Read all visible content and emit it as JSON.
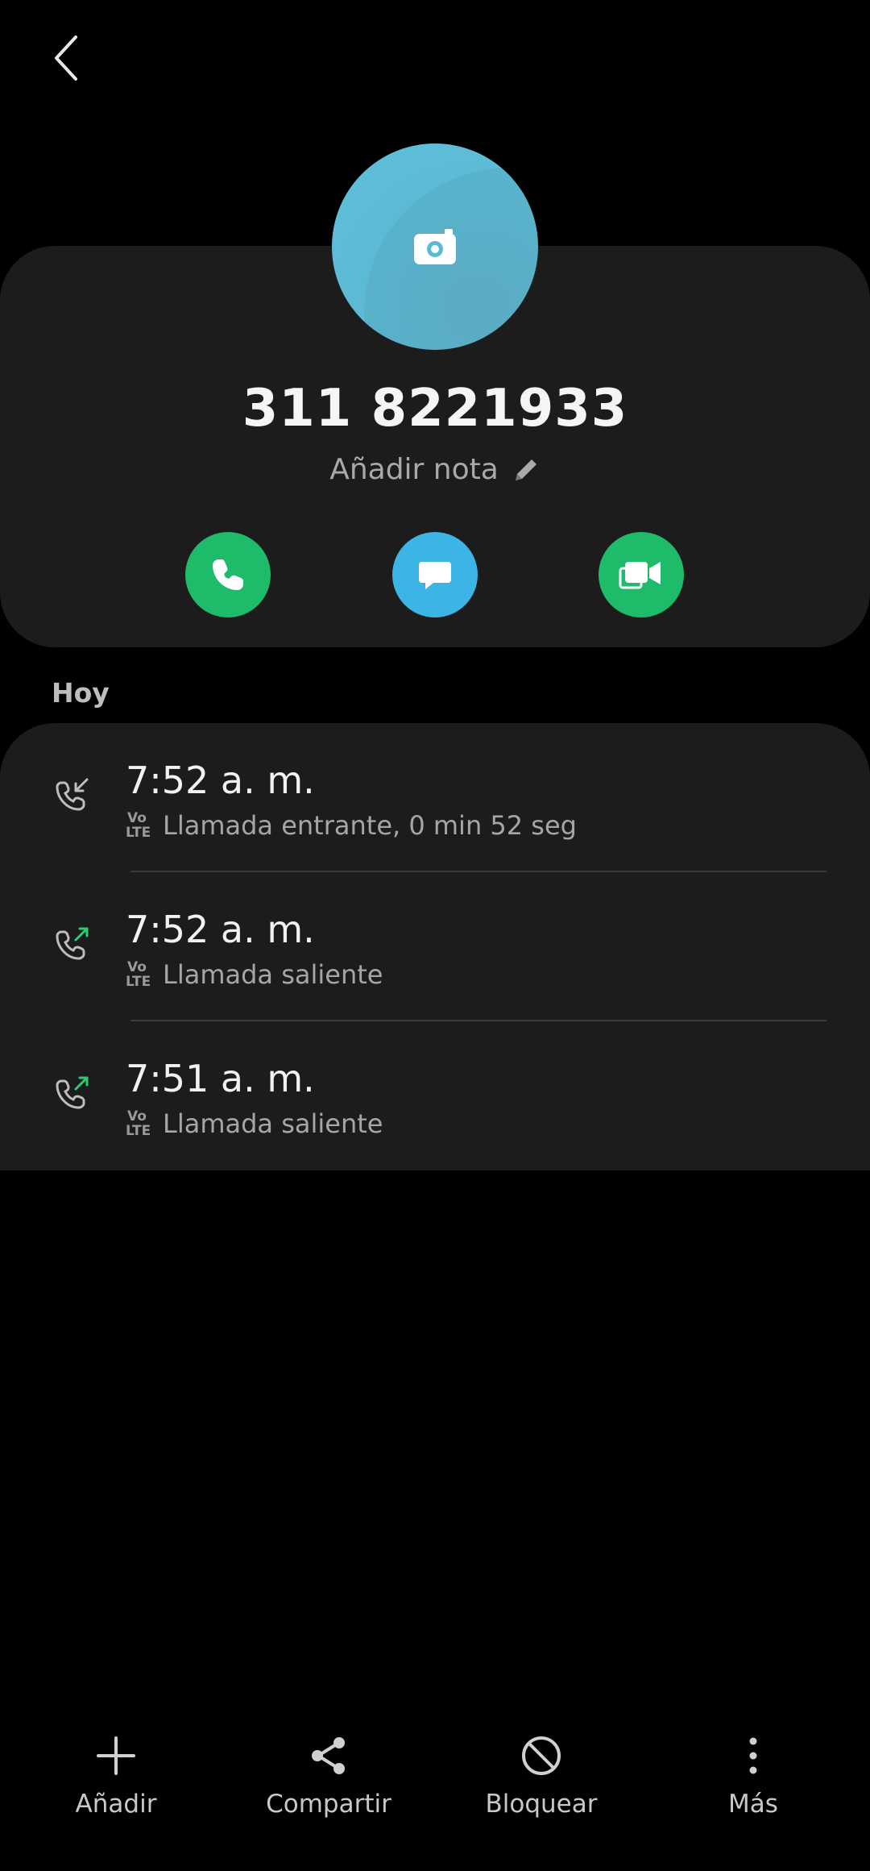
{
  "header": {
    "back_icon": "chevron-left-icon"
  },
  "contact": {
    "avatar_icon": "camera-icon",
    "avatar_color": "#5ec0da",
    "phone_number": "311 8221933",
    "note_label": "Añadir nota",
    "note_icon": "pencil-icon"
  },
  "actions": {
    "call_icon": "phone-icon",
    "message_icon": "message-icon",
    "video_icon": "video-call-icon",
    "call_color": "#1dbb6a",
    "message_color": "#3db4e6",
    "video_color": "#1dbb6a"
  },
  "log": {
    "section_label": "Hoy",
    "volte_top": "Vo",
    "volte_bottom": "LTE",
    "entries": [
      {
        "time": "7:52 a. m.",
        "description": "Llamada entrante, 0 min 52 seg",
        "icon": "incoming-call-icon"
      },
      {
        "time": "7:52 a. m.",
        "description": "Llamada saliente",
        "icon": "outgoing-call-icon"
      },
      {
        "time": "7:51 a. m.",
        "description": "Llamada saliente",
        "icon": "outgoing-call-icon"
      }
    ]
  },
  "bottom_bar": {
    "items": [
      {
        "label": "Añadir",
        "icon": "plus-icon"
      },
      {
        "label": "Compartir",
        "icon": "share-icon"
      },
      {
        "label": "Bloquear",
        "icon": "block-icon"
      },
      {
        "label": "Más",
        "icon": "more-vertical-icon"
      }
    ]
  }
}
